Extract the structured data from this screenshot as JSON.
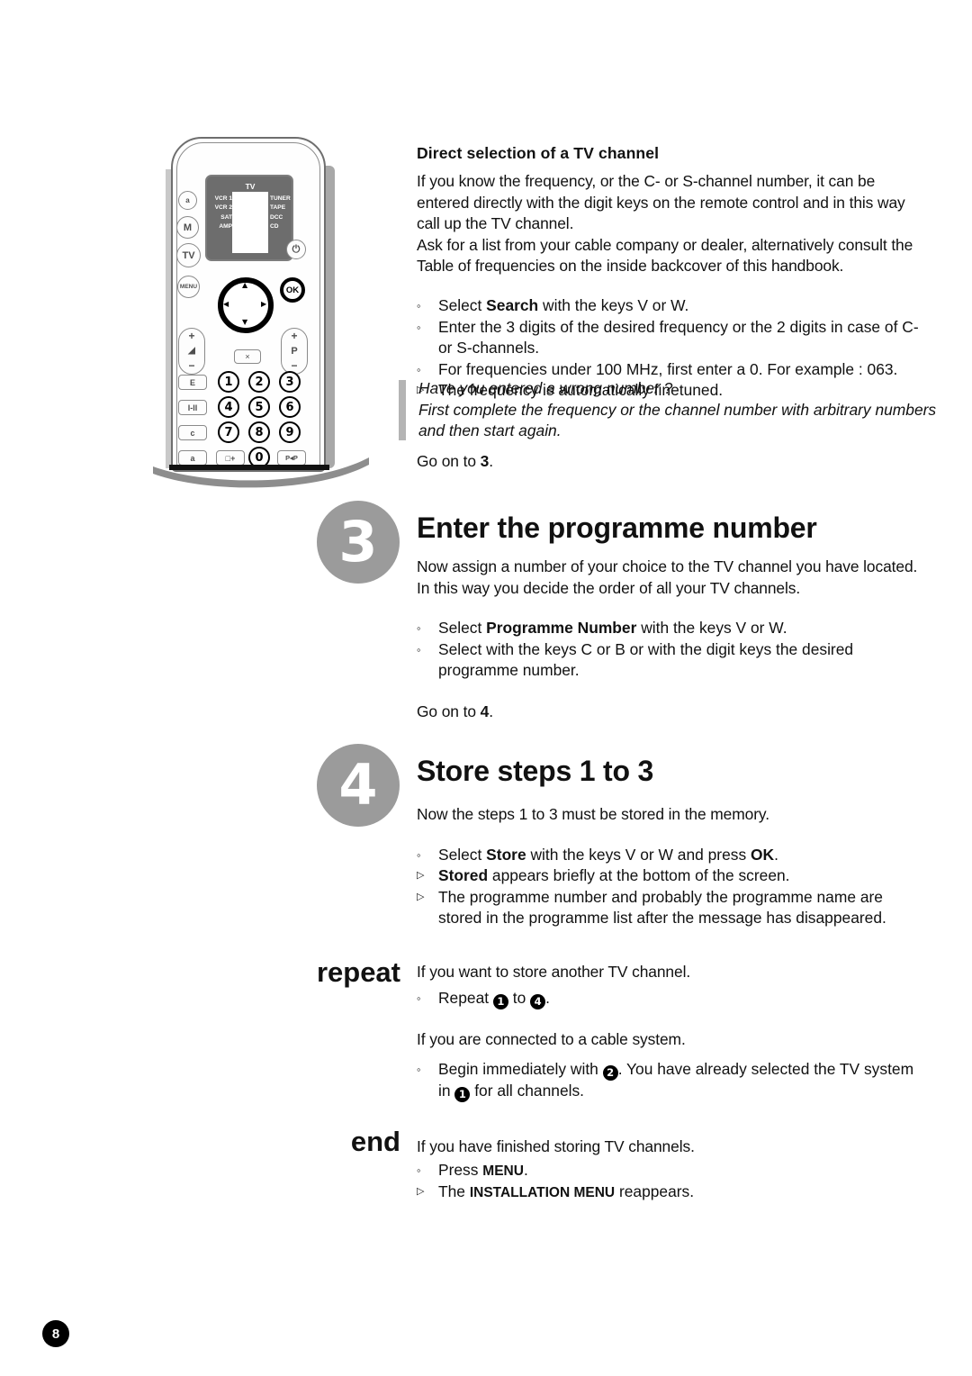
{
  "page": {
    "number": "8"
  },
  "remote": {
    "display": {
      "selected": "TV",
      "left_devices": [
        "VCR 1",
        "VCR 2",
        "SAT",
        "AMP"
      ],
      "right_devices": [
        "TUNER",
        "TAPE",
        "DCC",
        "CD"
      ]
    },
    "side_buttons": [
      "a",
      "M",
      "TV",
      "MENU"
    ],
    "power_label": "⏻",
    "ok_label": "OK",
    "ring_labels": {
      "up": "▲",
      "down": "▼",
      "left": "◀",
      "right": "▶"
    },
    "volume": {
      "plus": "+",
      "minus": "−",
      "icon": "◢"
    },
    "programme": {
      "plus": "+",
      "label": "P",
      "minus": "−"
    },
    "mute_label": "×",
    "function_keys": [
      "E",
      "I-II",
      "c",
      "a"
    ],
    "digit_keys": [
      "1",
      "2",
      "3",
      "4",
      "5",
      "6",
      "7",
      "8",
      "9"
    ],
    "zero_key": "0",
    "extra_keys": [
      "□+",
      "P◂P"
    ]
  },
  "intro": {
    "heading": "Direct selection of a TV channel",
    "paragraph1": "If you know the frequency, or the C- or S-channel number, it can be entered directly with the digit keys on the remote control and in this way call up the TV channel.",
    "paragraph2": "Ask for a list from your cable company or dealer, alternatively consult the Table of frequencies on the inside backcover of this handbook.",
    "bullets": [
      {
        "marker": "circle",
        "pre": "Select ",
        "bold": "Search",
        "post": " with the keys V  or W."
      },
      {
        "marker": "circle",
        "pre": "Enter the 3 digits of the desired frequency or the 2 digits in case of C-or S-channels.",
        "bold": "",
        "post": ""
      },
      {
        "marker": "circle",
        "pre": "For frequencies under 100 MHz, first enter a 0. For example : 063.",
        "bold": "",
        "post": ""
      },
      {
        "marker": "triangle",
        "pre": "The frequency is automatically finetuned.",
        "bold": "",
        "post": ""
      }
    ],
    "note": {
      "line1": "Have you entered a wrong number ?",
      "line2": "First complete the frequency or the channel number with arbitrary numbers and then start again."
    },
    "goon_pre": "Go on to ",
    "goon_bold": "3",
    "goon_post": "."
  },
  "step3": {
    "badge": "3",
    "title": "Enter the programme number",
    "paragraph": "Now assign a number of your choice to the TV channel you have located. In this way you decide the order of all your TV channels.",
    "bullets": [
      {
        "marker": "circle",
        "pre": "Select ",
        "bold": "Programme Number",
        "post": " with the keys V  or W."
      },
      {
        "marker": "circle",
        "pre": "Select with the keys C or B  or with the digit keys the desired programme number.",
        "bold": "",
        "post": ""
      }
    ],
    "goon_pre": "Go on to ",
    "goon_bold": "4",
    "goon_post": "."
  },
  "step4": {
    "badge": "4",
    "title": "Store steps 1 to 3",
    "paragraph": "Now the steps 1 to 3 must be stored in the memory.",
    "bullets": [
      {
        "marker": "circle",
        "pre": "Select ",
        "bold": "Store",
        "mid": " with the keys V  or W and press ",
        "bold2": "OK",
        "post": "."
      },
      {
        "marker": "triangle",
        "bold": "Stored",
        "post": " appears briefly at the bottom of the screen."
      },
      {
        "marker": "triangle",
        "pre": "The programme number and probably the programme name are stored in the programme list after the message has disappeared.",
        "bold": "",
        "post": ""
      }
    ]
  },
  "repeat": {
    "label": "repeat",
    "line1": "If you want to store another TV channel.",
    "bullet1_pre": "Repeat ",
    "bullet1_n1": "1",
    "bullet1_mid": " to ",
    "bullet1_n2": "4",
    "bullet1_post": ".",
    "line2": "If you are connected to a cable system.",
    "bullet2_pre": "Begin immediately with ",
    "bullet2_n1": "2",
    "bullet2_mid": ". You have already selected the TV system in ",
    "bullet2_n2": "1",
    "bullet2_post": " for all channels."
  },
  "end": {
    "label": "end",
    "line1": "If you have finished storing TV channels.",
    "bullet1_pre": "Press ",
    "bullet1_bold": "MENU",
    "bullet1_post": ".",
    "bullet2_pre": "The ",
    "bullet2_bold": "INSTALLATION MENU",
    "bullet2_post": " reappears."
  },
  "colors": {
    "step_badge": "#9b9b9b",
    "note_bar": "#b4b4b4",
    "ink": "#111111"
  }
}
